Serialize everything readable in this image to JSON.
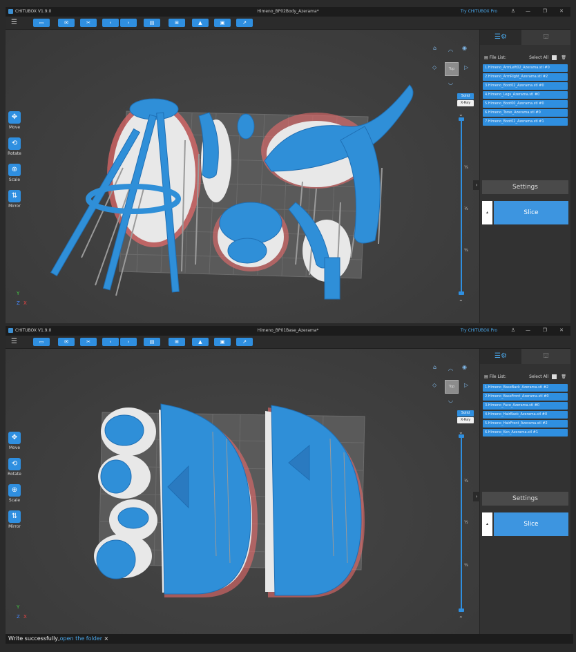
{
  "colors": {
    "accent": "#2f8fe0",
    "model": "#2f8fd8",
    "background": "#3f3f3f",
    "support": "#e8e8e8",
    "raft": "#e86a6a"
  },
  "window1": {
    "app": "CHITUBOX V1.9.0",
    "title": "Himeno_BP02Body_Azerama*",
    "pro_link": "Try CHITUBOX Pro",
    "left_tools": [
      {
        "label": "Move",
        "icon": "move-icon"
      },
      {
        "label": "Rotate",
        "icon": "rotate-icon"
      },
      {
        "label": "Scale",
        "icon": "scale-icon"
      },
      {
        "label": "Mirror",
        "icon": "mirror-icon"
      }
    ],
    "view_cube": "Top",
    "solid": "Solid",
    "xray": "X-Ray",
    "slider_ticks": [
      "¼",
      "½",
      "¾"
    ],
    "file_list_label": "File List:",
    "select_all": "Select All",
    "files": [
      "1.Himeno_ArmLeft02_Azerama.stl #0",
      "2.Himeno_ArmRight_Azerama.stl #2",
      "3.Himeno_Boot02_Azerama.stl #0",
      "4.Himeno_Legs_Azerama.stl #0",
      "5.Himeno_Boot00_Azerama.stl #0",
      "6.Himeno_Torso_Azerama.stl #0",
      "7.Himeno_Boot02_Azerama.stl #1"
    ],
    "settings": "Settings",
    "slice": "Slice"
  },
  "window2": {
    "app": "CHITUBOX V1.9.0",
    "title": "Himeno_BP01Base_Azerama*",
    "pro_link": "Try CHITUBOX Pro",
    "left_tools": [
      {
        "label": "Move",
        "icon": "move-icon"
      },
      {
        "label": "Rotate",
        "icon": "rotate-icon"
      },
      {
        "label": "Scale",
        "icon": "scale-icon"
      },
      {
        "label": "Mirror",
        "icon": "mirror-icon"
      }
    ],
    "view_cube": "Top",
    "solid": "Solid",
    "xray": "X-Ray",
    "slider_ticks": [
      "¼",
      "½",
      "¾"
    ],
    "file_list_label": "File List:",
    "select_all": "Select All",
    "files": [
      "1.Himeno_BaseBack_Azerama.stl #2",
      "2.Himeno_BaseFront_Azerama.stl #0",
      "3.Himeno_Face_Azerama.stl #0",
      "4.Himeno_HairBack_Azerama.stl #0",
      "5.Himeno_HairFront_Azerama.stl #2",
      "6.Himeno_Kon_Azerama.stl #1"
    ],
    "settings": "Settings",
    "slice": "Slice"
  },
  "status": {
    "message": "Write successfully,",
    "link": "open the folder",
    "close": "×"
  }
}
